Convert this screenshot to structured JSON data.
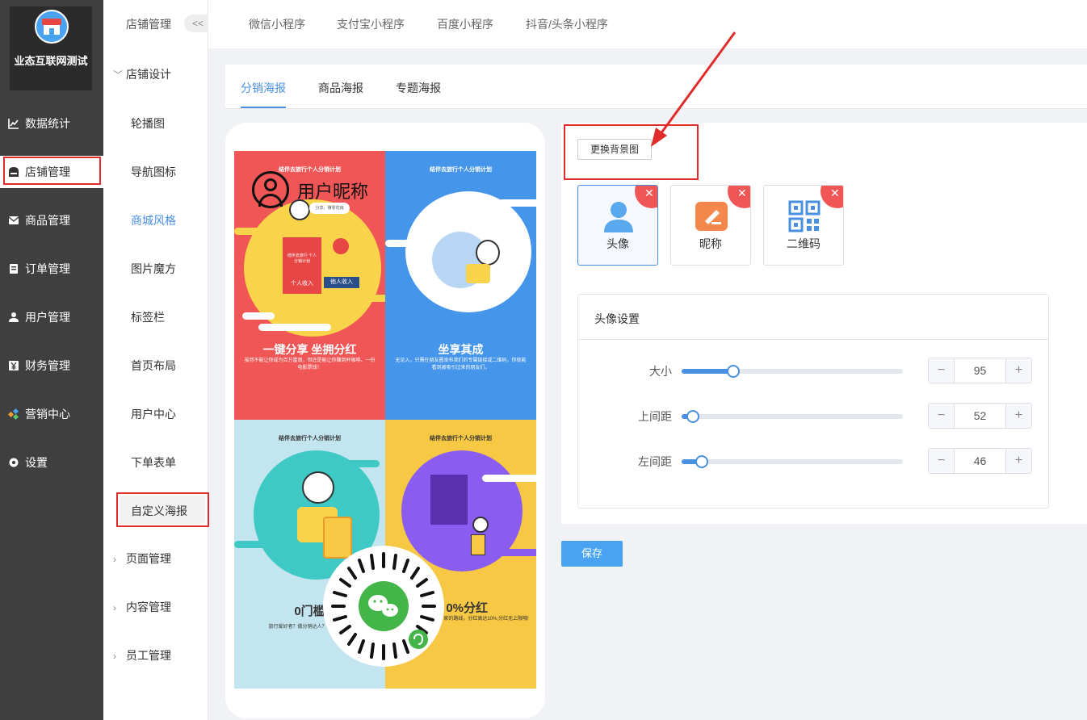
{
  "brand": {
    "name": "业态互联网测试"
  },
  "nav": {
    "items": [
      {
        "label": "数据统计",
        "icon": "line-chart-icon"
      },
      {
        "label": "店铺管理",
        "icon": "store-icon"
      },
      {
        "label": "商品管理",
        "icon": "mail-icon"
      },
      {
        "label": "订单管理",
        "icon": "order-icon"
      },
      {
        "label": "用户管理",
        "icon": "user-icon"
      },
      {
        "label": "财务管理",
        "icon": "yen-icon"
      },
      {
        "label": "营销中心",
        "icon": "marketing-icon"
      },
      {
        "label": "设置",
        "icon": "settings-icon"
      }
    ]
  },
  "subnav": {
    "title": "店铺管理",
    "collapse": "<<",
    "group_design": "店铺设计",
    "items": [
      "轮播图",
      "导航图标",
      "商城风格",
      "图片魔方",
      "标签栏",
      "首页布局",
      "用户中心",
      "下单表单",
      "自定义海报"
    ],
    "groups": [
      "页面管理",
      "内容管理",
      "员工管理"
    ]
  },
  "top_tabs": [
    "微信小程序",
    "支付宝小程序",
    "百度小程序",
    "抖音/头条小程序"
  ],
  "content_tabs": [
    "分销海报",
    "商品海报",
    "专题海报"
  ],
  "poster": {
    "nickname": "用户昵称",
    "head": "结伴去旅行个人分销计划",
    "q1_title": "一键分享 坐拥分红",
    "q1_sub": "虽然不能让你成为百万富翁，但还是能让你赚到杯咖啡、一份电影票钱！",
    "q1_tag1": "个人收入",
    "q1_tag2": "他人收入",
    "q1_box": "结伴去旅行 个人分销计划",
    "q1_bubble": "分享，赚零花钱",
    "q2_title": "坐享其成",
    "q2_sub": "无论入，只需在朋友圈发布我们的专属链接或二维码，你就能看到被吸引过来的朋友们。",
    "q3_title": "0门槛",
    "q3_sub": "旅行爱好者？做分销达人？旅游搭从业",
    "q4_title": "0%分红",
    "q4_sub": "家的路线，分红高达10%,分红无上限哦!"
  },
  "editor": {
    "change_bg": "更换背景图",
    "elements": [
      {
        "label": "头像",
        "icon": "avatar-icon"
      },
      {
        "label": "昵称",
        "icon": "nickname-icon"
      },
      {
        "label": "二维码",
        "icon": "qrcode-icon"
      }
    ],
    "settings_title": "头像设置",
    "rows": [
      {
        "label": "大小",
        "value": "95",
        "level": 0.21
      },
      {
        "label": "上间距",
        "value": "52",
        "level": 0.03
      },
      {
        "label": "左间距",
        "value": "46",
        "level": 0.07
      }
    ],
    "minus": "−",
    "plus": "+",
    "save": "保存"
  }
}
